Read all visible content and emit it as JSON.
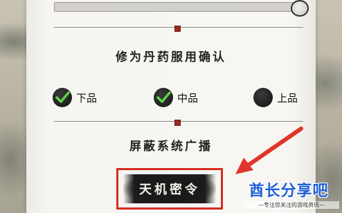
{
  "confirm_heading": "修为丹药服用确认",
  "options": [
    {
      "label": "下品",
      "checked": true
    },
    {
      "label": "中品",
      "checked": true
    },
    {
      "label": "上品",
      "checked": false
    }
  ],
  "broadcast_heading": "屏蔽系统广播",
  "tianji_button": "天机密令",
  "watermark": {
    "brand": "酋长分享吧",
    "tagline": "—专注您关注的游戏资讯—"
  },
  "colors": {
    "highlight_box": "#d8291f",
    "arrow": "#e0352a",
    "check_green": "#5fd24a",
    "brand_blue": "#1f5fd6"
  }
}
